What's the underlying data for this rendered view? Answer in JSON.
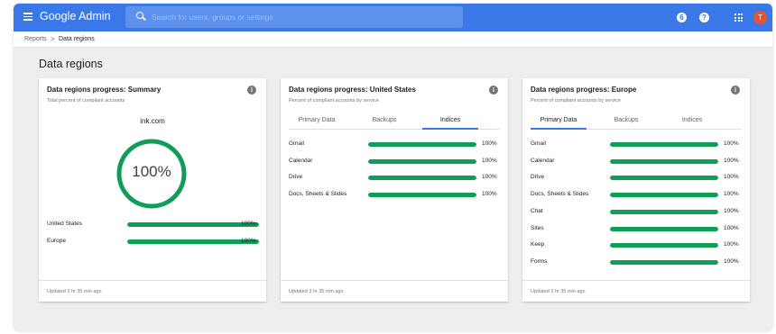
{
  "header": {
    "brand": "Google Admin",
    "search_placeholder": "Search for users, groups or settings",
    "notifications_icon_text": "6",
    "help_icon_text": "?",
    "avatar_initial": "T"
  },
  "breadcrumb": {
    "parent": "Reports",
    "separator": ">",
    "current": "Data regions"
  },
  "page": {
    "title": "Data regions"
  },
  "colors": {
    "topbar": "#3b78e7",
    "progress": "#0f9d58",
    "avatar": "#e8542f"
  },
  "cards": [
    {
      "title": "Data regions progress: Summary",
      "subtitle": "Total percent of compliant accounts",
      "domain": "ink.com",
      "overall": "100%",
      "overall_fraction": 1.0,
      "rows": [
        {
          "label": "United States",
          "value": "100%",
          "fraction": 1.0
        },
        {
          "label": "Europe",
          "value": "100%",
          "fraction": 1.0
        }
      ],
      "footer": "Updated 3 hr 35 min ago"
    },
    {
      "title": "Data regions progress: United States",
      "subtitle": "Percent of compliant accounts by service",
      "tabs": [
        "Primary Data",
        "Backups",
        "Indices"
      ],
      "active_tab": 2,
      "rows": [
        {
          "label": "Gmail",
          "value": "100%",
          "fraction": 1.0
        },
        {
          "label": "Calendar",
          "value": "100%",
          "fraction": 1.0
        },
        {
          "label": "Drive",
          "value": "100%",
          "fraction": 1.0
        },
        {
          "label": "Docs, Sheets & Slides",
          "value": "100%",
          "fraction": 1.0
        }
      ],
      "footer": "Updated 3 hr 35 min ago"
    },
    {
      "title": "Data regions progress: Europe",
      "subtitle": "Percent of compliant accounts by service",
      "tabs": [
        "Primary Data",
        "Backups",
        "Indices"
      ],
      "active_tab": 0,
      "rows": [
        {
          "label": "Gmail",
          "value": "100%",
          "fraction": 1.0
        },
        {
          "label": "Calendar",
          "value": "100%",
          "fraction": 1.0
        },
        {
          "label": "Drive",
          "value": "100%",
          "fraction": 1.0
        },
        {
          "label": "Docs, Sheets & Slides",
          "value": "100%",
          "fraction": 1.0
        },
        {
          "label": "Chat",
          "value": "100%",
          "fraction": 1.0
        },
        {
          "label": "Sites",
          "value": "100%",
          "fraction": 1.0
        },
        {
          "label": "Keep",
          "value": "100%",
          "fraction": 1.0
        },
        {
          "label": "Forms",
          "value": "100%",
          "fraction": 1.0
        }
      ],
      "footer": "Updated 3 hr 35 min ago"
    }
  ]
}
